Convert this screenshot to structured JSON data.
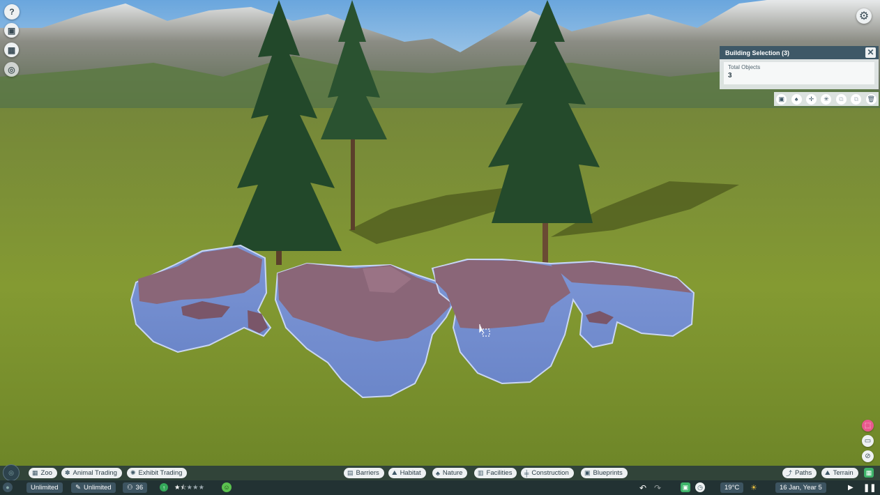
{
  "left_buttons": [
    {
      "name": "help-button",
      "glyph": "?"
    },
    {
      "name": "zoo-info-button",
      "glyph": "▣"
    },
    {
      "name": "calendar-button",
      "glyph": "▦"
    },
    {
      "name": "view-toggle-button",
      "glyph": "◎"
    }
  ],
  "selection_panel": {
    "title": "Building Selection (3)",
    "total_objects_label": "Total Objects",
    "total_objects_value": "3",
    "close_glyph": "✕"
  },
  "tools": [
    "▣",
    "♠",
    "✛",
    "✳",
    "⧉",
    "⧉",
    "🗑"
  ],
  "top_menu": {
    "zoo": "Zoo",
    "animal_trading": "Animal Trading",
    "exhibit_trading": "Exhibit Trading",
    "barriers": "Barriers",
    "habitat": "Habitat",
    "nature": "Nature",
    "facilities": "Facilities",
    "construction": "Construction",
    "blueprints": "Blueprints",
    "paths": "Paths",
    "terrain": "Terrain"
  },
  "status": {
    "money": "Unlimited",
    "research": "Unlimited",
    "guests": "36",
    "rating_stars": 1.5,
    "rating_max": 5,
    "temperature": "19°C",
    "date": "16 Jan, Year 5"
  },
  "colors": {
    "panel_header": "#3e5867",
    "water_highlight": "#6f8fd9",
    "grass": "#7a9130",
    "sky": "#8fbfe6"
  }
}
